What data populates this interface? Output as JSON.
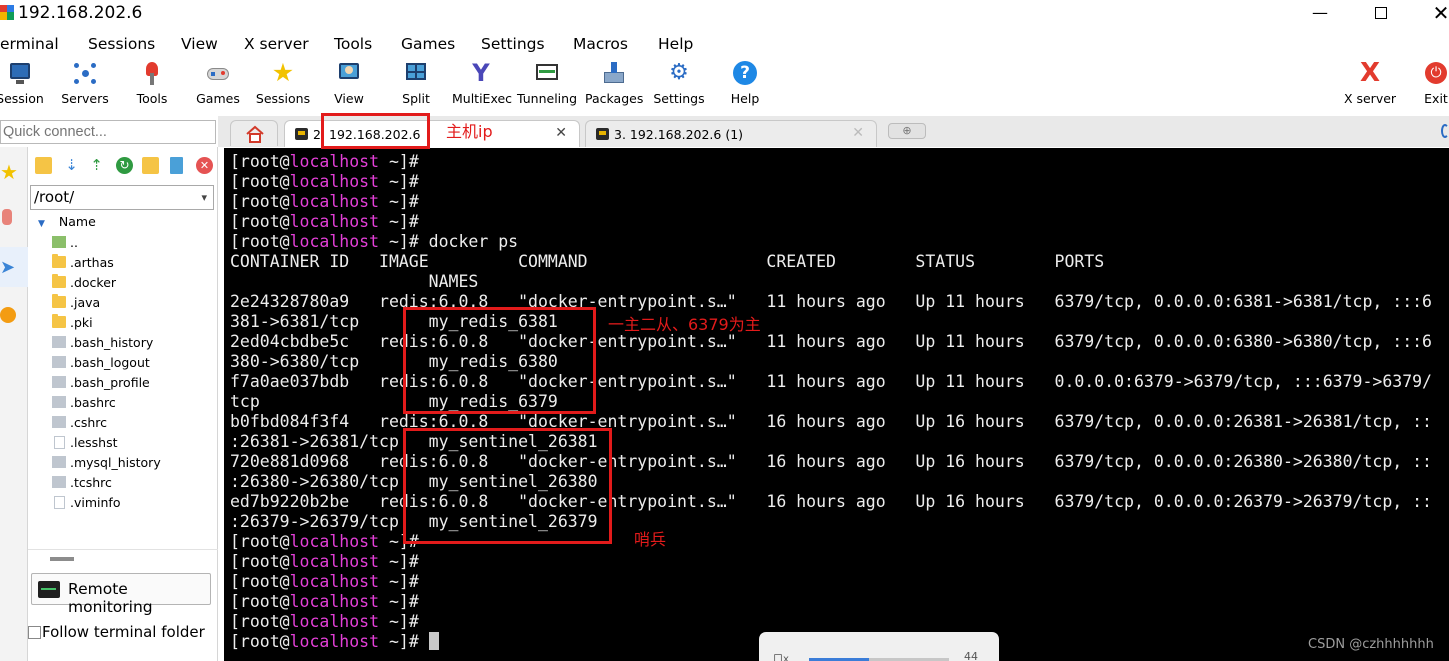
{
  "window": {
    "title": "192.168.202.6",
    "minimize_label": "—",
    "close_label": "✕"
  },
  "menu": [
    "erminal",
    "Sessions",
    "View",
    "X server",
    "Tools",
    "Games",
    "Settings",
    "Macros",
    "Help"
  ],
  "toolbar": [
    {
      "label": "Session",
      "icon": "session-icon"
    },
    {
      "label": "Servers",
      "icon": "servers-icon"
    },
    {
      "label": "Tools",
      "icon": "tools-icon"
    },
    {
      "label": "Games",
      "icon": "games-icon"
    },
    {
      "label": "Sessions",
      "icon": "star-icon"
    },
    {
      "label": "View",
      "icon": "view-icon"
    },
    {
      "label": "Split",
      "icon": "split-icon"
    },
    {
      "label": "MultiExec",
      "icon": "multiexec-icon"
    },
    {
      "label": "Tunneling",
      "icon": "tunneling-icon"
    },
    {
      "label": "Packages",
      "icon": "packages-icon"
    },
    {
      "label": "Settings",
      "icon": "settings-icon"
    },
    {
      "label": "Help",
      "icon": "help-icon"
    },
    {
      "label": "X server",
      "icon": "xserver-icon"
    },
    {
      "label": "Exit",
      "icon": "exit-icon"
    }
  ],
  "quick_connect": {
    "placeholder": "Quick connect..."
  },
  "tabs": {
    "active": {
      "number": "2",
      "label": "192.168.202.6",
      "close": "✕"
    },
    "inactive": {
      "label": "3. 192.168.202.6 (1)",
      "close": "✕"
    },
    "new_tab": "⊕"
  },
  "sidebar": {
    "path": "/root/",
    "tree_header": "Name",
    "files": [
      {
        "name": "..",
        "type": "up"
      },
      {
        "name": ".arthas",
        "type": "folder"
      },
      {
        "name": ".docker",
        "type": "folder"
      },
      {
        "name": ".java",
        "type": "folder"
      },
      {
        "name": ".pki",
        "type": "folder"
      },
      {
        "name": ".bash_history",
        "type": "file"
      },
      {
        "name": ".bash_logout",
        "type": "file"
      },
      {
        "name": ".bash_profile",
        "type": "file"
      },
      {
        "name": ".bashrc",
        "type": "file"
      },
      {
        "name": ".cshrc",
        "type": "file"
      },
      {
        "name": ".lesshst",
        "type": "doc"
      },
      {
        "name": ".mysql_history",
        "type": "file"
      },
      {
        "name": ".tcshrc",
        "type": "file"
      },
      {
        "name": ".viminfo",
        "type": "doc"
      }
    ],
    "remote_monitoring": "Remote monitoring",
    "follow_terminal": "Follow terminal folder"
  },
  "terminal": {
    "prompt_user": "[root@",
    "prompt_host": "localhost",
    "prompt_tail": " ~]#",
    "lines": [
      {
        "type": "prompt",
        "cmd": ""
      },
      {
        "type": "prompt",
        "cmd": ""
      },
      {
        "type": "prompt",
        "cmd": ""
      },
      {
        "type": "prompt",
        "cmd": ""
      },
      {
        "type": "prompt",
        "cmd": " docker ps"
      },
      {
        "type": "text",
        "text": "CONTAINER ID   IMAGE         COMMAND                  CREATED        STATUS        PORTS"
      },
      {
        "type": "text",
        "text": "                    NAMES"
      },
      {
        "type": "text",
        "text": "2e24328780a9   redis:6.0.8   \"docker-entrypoint.s…\"   11 hours ago   Up 11 hours   6379/tcp, 0.0.0.0:6381->6381/tcp, :::6"
      },
      {
        "type": "text",
        "text": "381->6381/tcp       my_redis_6381"
      },
      {
        "type": "text",
        "text": "2ed04cbdbe5c   redis:6.0.8   \"docker-entrypoint.s…\"   11 hours ago   Up 11 hours   6379/tcp, 0.0.0.0:6380->6380/tcp, :::6"
      },
      {
        "type": "text",
        "text": "380->6380/tcp       my_redis_6380"
      },
      {
        "type": "text",
        "text": "f7a0ae037bdb   redis:6.0.8   \"docker-entrypoint.s…\"   11 hours ago   Up 11 hours   0.0.0.0:6379->6379/tcp, :::6379->6379/"
      },
      {
        "type": "text",
        "text": "tcp                 my_redis_6379"
      },
      {
        "type": "text",
        "text": "b0fbd084f3f4   redis:6.0.8   \"docker-entrypoint.s…\"   16 hours ago   Up 16 hours   6379/tcp, 0.0.0.0:26381->26381/tcp, ::"
      },
      {
        "type": "text",
        "text": ":26381->26381/tcp   my_sentinel_26381"
      },
      {
        "type": "text",
        "text": "720e881d0968   redis:6.0.8   \"docker-entrypoint.s…\"   16 hours ago   Up 16 hours   6379/tcp, 0.0.0.0:26380->26380/tcp, ::"
      },
      {
        "type": "text",
        "text": ":26380->26380/tcp   my_sentinel_26380"
      },
      {
        "type": "text",
        "text": "ed7b9220b2be   redis:6.0.8   \"docker-entrypoint.s…\"   16 hours ago   Up 16 hours   6379/tcp, 0.0.0.0:26379->26379/tcp, ::"
      },
      {
        "type": "text",
        "text": ":26379->26379/tcp   my_sentinel_26379"
      },
      {
        "type": "prompt",
        "cmd": ""
      },
      {
        "type": "prompt",
        "cmd": ""
      },
      {
        "type": "prompt",
        "cmd": ""
      },
      {
        "type": "prompt",
        "cmd": ""
      },
      {
        "type": "prompt",
        "cmd": ""
      },
      {
        "type": "prompt",
        "cmd": "",
        "cursor": true
      }
    ]
  },
  "annotations": {
    "host_ip": "主机ip",
    "master_slave": "一主二从、6379为主",
    "sentinel": "哨兵",
    "color": "#e21b1b"
  },
  "watermark": "CSDN @czhhhhhhh",
  "popup": {
    "left": "口x",
    "right": "44"
  }
}
